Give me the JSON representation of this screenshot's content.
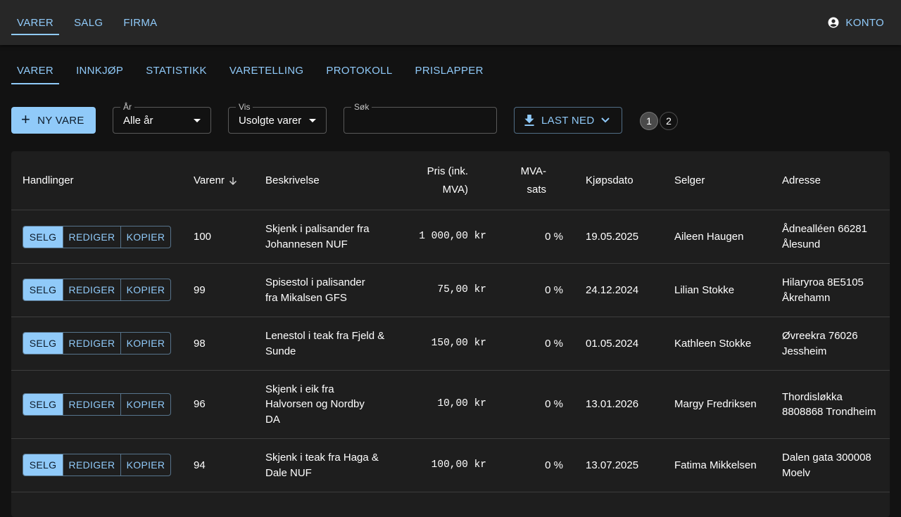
{
  "topnav": {
    "items": [
      {
        "label": "VARER",
        "active": true
      },
      {
        "label": "SALG",
        "active": false
      },
      {
        "label": "FIRMA",
        "active": false
      }
    ],
    "account_label": "KONTO"
  },
  "subtabs": [
    {
      "label": "VARER",
      "active": true
    },
    {
      "label": "INNKJØP",
      "active": false
    },
    {
      "label": "STATISTIKK",
      "active": false
    },
    {
      "label": "VARETELLING",
      "active": false
    },
    {
      "label": "PROTOKOLL",
      "active": false
    },
    {
      "label": "PRISLAPPER",
      "active": false
    }
  ],
  "toolbar": {
    "new_label": "NY VARE",
    "year_label": "År",
    "year_value": "Alle år",
    "show_label": "Vis",
    "show_value": "Usolgte varer",
    "search_label": "Søk",
    "search_value": "",
    "download_label": "LAST NED",
    "pages": [
      "1",
      "2"
    ],
    "current_page": "1"
  },
  "table": {
    "headers": {
      "actions": "Handlinger",
      "item_no": "Varenr",
      "description": "Beskrivelse",
      "price": "Pris (ink. MVA)",
      "vat": "MVA-sats",
      "purchase_date": "Kjøpsdato",
      "seller": "Selger",
      "address": "Adresse"
    },
    "sort_column": "item_no",
    "sort_direction": "descending",
    "actions": {
      "sell": "SELG",
      "edit": "REDIGER",
      "copy": "KOPIER"
    },
    "rows": [
      {
        "item_no": "100",
        "description": "Skjenk i palisander fra Johannesen NUF",
        "price": "1 000,00 kr",
        "vat": "0 %",
        "purchase_date": "19.05.2025",
        "seller": "Aileen Haugen",
        "address": "Ådnealléen 66281 Ålesund"
      },
      {
        "item_no": "99",
        "description": "Spisestol i palisander fra Mikalsen GFS",
        "price": "75,00 kr",
        "vat": "0 %",
        "purchase_date": "24.12.2024",
        "seller": "Lilian Stokke",
        "address": "Hilaryroa 8E5105 Åkrehamn"
      },
      {
        "item_no": "98",
        "description": "Lenestol i teak fra Fjeld & Sunde",
        "price": "150,00 kr",
        "vat": "0 %",
        "purchase_date": "01.05.2024",
        "seller": "Kathleen Stokke",
        "address": "Øvreekra 76026 Jessheim"
      },
      {
        "item_no": "96",
        "description": "Skjenk i eik fra Halvorsen og Nordby DA",
        "price": "10,00 kr",
        "vat": "0 %",
        "purchase_date": "13.01.2026",
        "seller": "Margy Fredriksen",
        "address": "Thordisløkka 8808868 Trondheim"
      },
      {
        "item_no": "94",
        "description": "Skjenk i teak fra Haga & Dale NUF",
        "price": "100,00 kr",
        "vat": "0 %",
        "purchase_date": "13.07.2025",
        "seller": "Fatima Mikkelsen",
        "address": "Dalen gata 300008 Moelv"
      }
    ]
  },
  "colors": {
    "accent": "#90caf9",
    "appbar": "#272727",
    "background": "#121212",
    "paper": "#1e1e1e"
  }
}
